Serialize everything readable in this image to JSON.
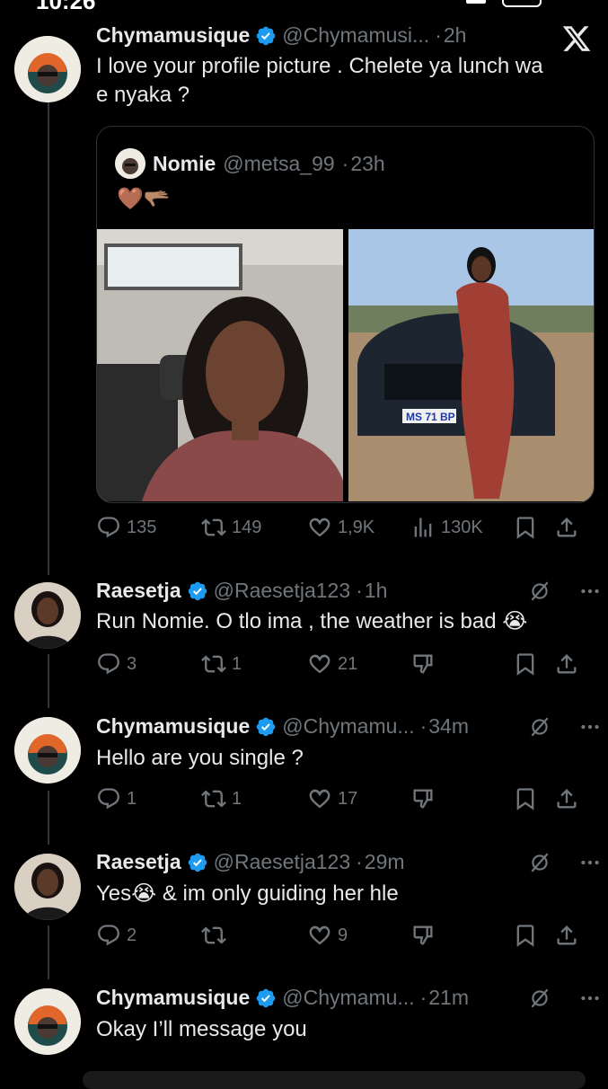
{
  "status": {
    "time": "10:26"
  },
  "original_tweet": {
    "name": "Chymamusique",
    "handle": "@Chymamusi...",
    "time": "2h",
    "text": "I love your profile picture . Chelete ya lunch wa\ne nyaka ?",
    "quote": {
      "name": "Nomie",
      "handle": "@metsa_99",
      "time": "23h",
      "emoji": "🤎🫳🏽"
    },
    "stats": {
      "replies": "135",
      "reposts": "149",
      "likes": "1,9K",
      "views": "130K"
    }
  },
  "replies": [
    {
      "name": "Raesetja",
      "handle": "@Raesetja123",
      "time": "1h",
      "text": "Run Nomie. O tlo ima , the weather is bad 😭",
      "replies": "3",
      "reposts": "1",
      "likes": "21"
    },
    {
      "name": "Chymamusique",
      "handle": "@Chymamu...",
      "time": "34m",
      "text": "Hello are you single ?",
      "replies": "1",
      "reposts": "1",
      "likes": "17"
    },
    {
      "name": "Raesetja",
      "handle": "@Raesetja123",
      "time": "29m",
      "text": "Yes😭 & im only guiding her hle",
      "replies": "2",
      "reposts": "",
      "likes": "9"
    },
    {
      "name": "Chymamusique",
      "handle": "@Chymamu...",
      "time": "21m",
      "text": "Okay I’ll message you"
    }
  ],
  "car_plate": "MS 71 BP",
  "colors": {
    "bg": "#000000",
    "text": "#e7e9ea",
    "muted": "#71767b",
    "verified": "#1d9bf0",
    "border": "#2f3336"
  }
}
